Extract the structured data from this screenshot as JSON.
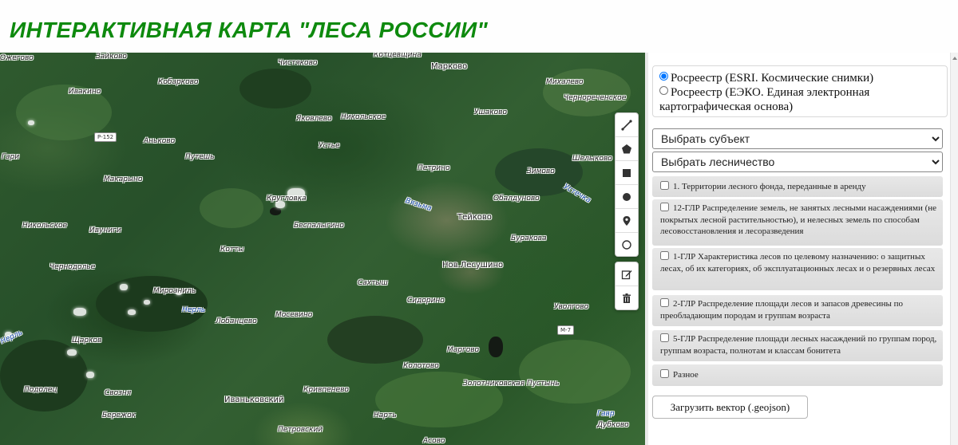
{
  "header": {
    "title": "ИНТЕРАКТИВНАЯ КАРТА \"ЛЕСА РОССИИ\""
  },
  "map": {
    "places": [
      "Зайково",
      "Ожегово",
      "Чистяково",
      "Котцевщина",
      "Марково",
      "Михалево",
      "Чернореченское",
      "Кобарково",
      "Ивакино",
      "Яковлево",
      "Никольское",
      "Ушаково",
      "Аньково",
      "Устье",
      "Гари",
      "Путешь",
      "Петрино",
      "Шелыково",
      "Зимово",
      "Макарыно",
      "Кругловка",
      "Обалдуново",
      "Никольское",
      "Ивуниги",
      "Беспалыгино",
      "Буракова",
      "Котты",
      "Чернодолье",
      "Мироаниль",
      "Сахтыш",
      "Сидорино",
      "Уволгово",
      "Лобанцево",
      "Мосевино",
      "Щарков",
      "Маргово",
      "Колотово",
      "Подолец",
      "Свозня",
      "Кривпенево",
      "Золотниковская Пустынь",
      "Бережок",
      "Нарть",
      "Петровский",
      "Дубково",
      "Асово"
    ],
    "towns": [
      "Тейково",
      "Нов.Лесушино",
      "Иваньковский"
    ],
    "rivers": [
      "Вязьма",
      "Нерль",
      "Нерль",
      "Устечка",
      "Гавр"
    ],
    "roads": [
      "Р-152",
      "М-7"
    ]
  },
  "draw_toolbar": {
    "icons": [
      "polyline-icon",
      "polygon-icon",
      "rectangle-icon",
      "circle-marker-icon",
      "marker-icon",
      "circle-icon"
    ]
  },
  "edit_toolbar": {
    "icons": [
      "edit-icon",
      "delete-icon"
    ]
  },
  "sidebar": {
    "basemap_options": [
      {
        "label": "Росреестр (ESRI. Космические снимки)",
        "checked": true
      },
      {
        "label": "Росреестр (ЕЭКО. Единая электронная картографическая основа)",
        "checked": false
      }
    ],
    "select_subject": "Выбрать субъект",
    "select_forestry": "Выбрать лесничество",
    "layers": [
      "1. Территории лесного фонда, переданные в аренду",
      "12-ГЛР Распределение земель, не занятых лесными насаждениями (не покрытых лесной растительностью), и нелесных земель по способам лесовосстановления и лесоразведения",
      "1-ГЛР Характеристика лесов по целевому назначению: о защитных лесах, об их категориях, об эксплуатационных лесах и о резервных лесах",
      "2-ГЛР Распределение площади лесов и запасов древесины по преобладающим породам и группам возраста",
      "5-ГЛР Распределение площади лесных насаждений по группам пород, группам возраста, полнотам и классам бонитета",
      "Разное"
    ],
    "upload_label": "Загрузить вектор (.geojson)"
  },
  "colors": {
    "title": "#0e8a0e",
    "layer_bg": "#e0e0e0",
    "river_label": "#1e4fb0"
  }
}
